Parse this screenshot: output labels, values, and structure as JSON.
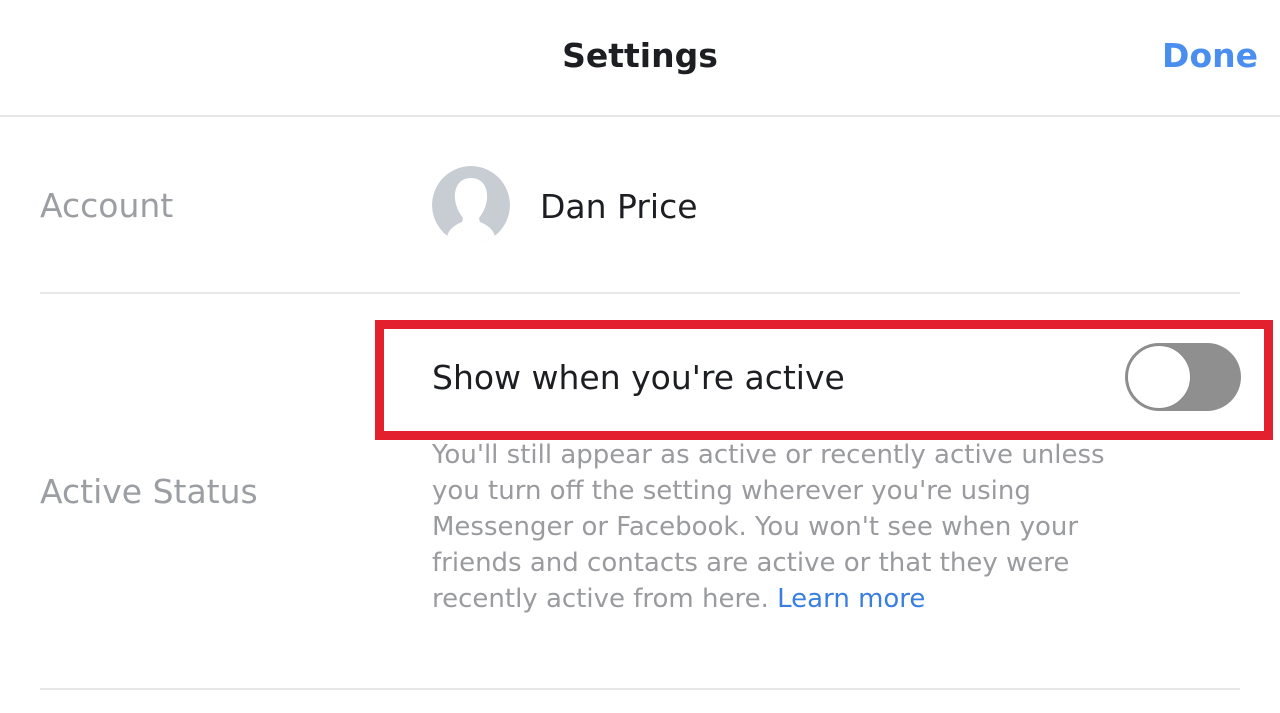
{
  "header": {
    "title": "Settings",
    "done_label": "Done"
  },
  "account": {
    "label": "Account",
    "name": "Dan Price",
    "avatar_icon": "person-silhouette-icon"
  },
  "active_status": {
    "label": "Active Status",
    "toggle_label": "Show when you're active",
    "toggle_on": false,
    "description": "You'll still appear as active or recently active unless you turn off the setting wherever you're using Messenger or Facebook. You won't see when your friends and contacts are active or that they were recently active from here.",
    "learn_more": "Learn more"
  },
  "colors": {
    "accent": "#4a8ff0",
    "highlight": "#e3202d",
    "toggle_off": "#8f8f8f",
    "muted_text": "#9b9ea3"
  }
}
